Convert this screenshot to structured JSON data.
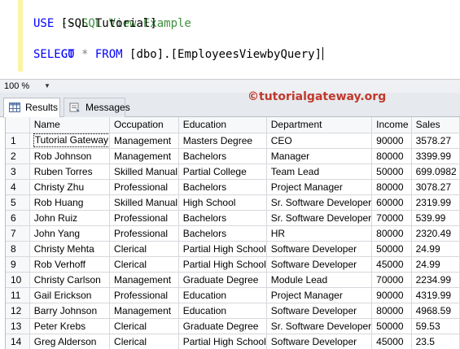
{
  "editor": {
    "lines": {
      "l1_comment": "-- SQL View Example",
      "l2_keyword": "USE",
      "l2_rest": " [SQL Tutorial]",
      "l3_keyword": "GO",
      "l4_keyword_select": "SELECT",
      "l4_star": " * ",
      "l4_keyword_from": "FROM",
      "l4_rest": " [dbo].[EmployeesViewbyQuery]"
    },
    "comment_color": "#3f8f3f",
    "keyword_color": "#0000ff"
  },
  "zoom": {
    "value": "100 %"
  },
  "tabs": {
    "results": "Results",
    "messages": "Messages"
  },
  "watermark": "©tutorialgateway.org",
  "results": {
    "columns": [
      "Name",
      "Occupation",
      "Education",
      "Department",
      "Income",
      "Sales"
    ],
    "rows": [
      [
        "1",
        "Tutorial Gateway",
        "Management",
        "Masters Degree",
        "CEO",
        "90000",
        "3578.27"
      ],
      [
        "2",
        "Rob Johnson",
        "Management",
        "Bachelors",
        "Manager",
        "80000",
        "3399.99"
      ],
      [
        "3",
        "Ruben Torres",
        "Skilled Manual",
        "Partial College",
        "Team Lead",
        "50000",
        "699.0982"
      ],
      [
        "4",
        "Christy Zhu",
        "Professional",
        "Bachelors",
        "Project Manager",
        "80000",
        "3078.27"
      ],
      [
        "5",
        "Rob Huang",
        "Skilled Manual",
        "High School",
        "Sr. Software Developer",
        "60000",
        "2319.99"
      ],
      [
        "6",
        "John Ruiz",
        "Professional",
        "Bachelors",
        "Sr. Software Developer",
        "70000",
        "539.99"
      ],
      [
        "7",
        "John Yang",
        "Professional",
        "Bachelors",
        "HR",
        "80000",
        "2320.49"
      ],
      [
        "8",
        "Christy Mehta",
        "Clerical",
        "Partial High School",
        "Software Developer",
        "50000",
        "24.99"
      ],
      [
        "9",
        "Rob Verhoff",
        "Clerical",
        "Partial High School",
        "Software Developer",
        "45000",
        "24.99"
      ],
      [
        "10",
        "Christy Carlson",
        "Management",
        "Graduate Degree",
        "Module Lead",
        "70000",
        "2234.99"
      ],
      [
        "11",
        "Gail Erickson",
        "Professional",
        "Education",
        "Project Manager",
        "90000",
        "4319.99"
      ],
      [
        "12",
        "Barry Johnson",
        "Management",
        "Education",
        "Software Developer",
        "80000",
        "4968.59"
      ],
      [
        "13",
        "Peter Krebs",
        "Clerical",
        "Graduate Degree",
        "Sr. Software Developer",
        "50000",
        "59.53"
      ],
      [
        "14",
        "Greg Alderson",
        "Clerical",
        "Partial High School",
        "Software Developer",
        "45000",
        "23.5"
      ]
    ]
  }
}
